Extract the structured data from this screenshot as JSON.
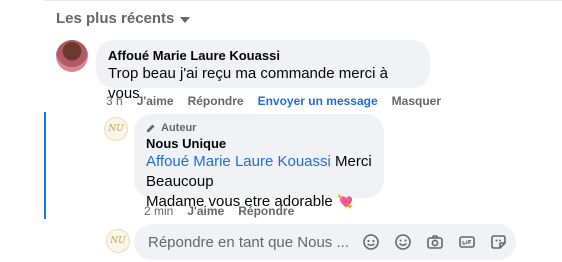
{
  "sort": {
    "label": "Les plus récents"
  },
  "comment": {
    "author": "Affoué Marie Laure Kouassi",
    "text": "Trop beau j'ai reçu ma commande merci à vous",
    "actions": {
      "time": "3 h",
      "like": "J'aime",
      "reply": "Répondre",
      "message": "Envoyer un message",
      "hide": "Masquer"
    }
  },
  "reply": {
    "badge": "Auteur",
    "author": "Nous Unique",
    "mention": "Affoué Marie Laure Kouassi",
    "text_after_mention": " Merci Beaucoup",
    "text_line2": "Madame vous etre adorable",
    "emoji": "💘",
    "actions": {
      "time": "2 min",
      "like": "J'aime",
      "reply": "Répondre"
    }
  },
  "reply_box": {
    "placeholder": "Répondre en tant que Nous ...",
    "icons": [
      "sticker-icon",
      "emoji-icon",
      "camera-icon",
      "gif-icon",
      "avatar-sticker-icon"
    ]
  },
  "colors": {
    "accent": "#1d6fd8",
    "thread_line": "#1877f2",
    "bubble": "#f0f2f5",
    "muted": "#65676b"
  },
  "page_avatar_initials": "NU"
}
